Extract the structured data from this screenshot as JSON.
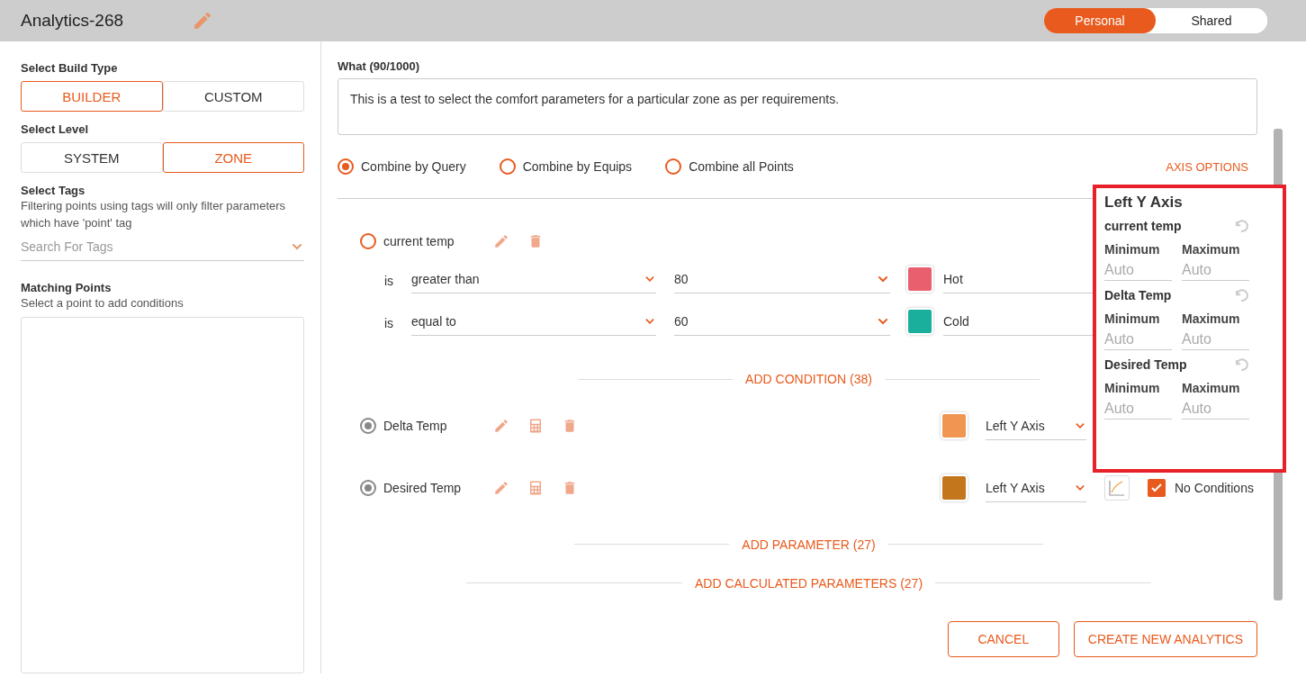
{
  "header": {
    "title": "Analytics-268",
    "scope_toggle": [
      {
        "label": "Personal",
        "selected": true
      },
      {
        "label": "Shared",
        "selected": false
      }
    ]
  },
  "sidebar": {
    "build_type": {
      "label": "Select Build Type",
      "options": [
        {
          "label": "BUILDER",
          "selected": true
        },
        {
          "label": "CUSTOM",
          "selected": false
        }
      ]
    },
    "level": {
      "label": "Select Level",
      "options": [
        {
          "label": "SYSTEM",
          "selected": false
        },
        {
          "label": "ZONE",
          "selected": true
        }
      ]
    },
    "tags": {
      "label": "Select Tags",
      "hint": "Filtering points using tags will only filter parameters which have 'point' tag",
      "placeholder": "Search For Tags"
    },
    "matching_points": {
      "label": "Matching Points",
      "hint": "Select a point to add conditions"
    }
  },
  "what": {
    "label": "What (90/1000)",
    "value": "This is a test to select the comfort parameters for a particular zone as per requirements."
  },
  "combine_options": [
    {
      "label": "Combine by Query",
      "selected": true
    },
    {
      "label": "Combine by Equips",
      "selected": false
    },
    {
      "label": "Combine all Points",
      "selected": false
    }
  ],
  "axis_options_link": "AXIS OPTIONS",
  "parameters": [
    {
      "kind": "query",
      "name": "current temp",
      "selected": false,
      "conditions": [
        {
          "operator": "is",
          "comparison": "greater than",
          "value": "80",
          "color": "#e95f6e",
          "label": "Hot"
        },
        {
          "operator": "is",
          "comparison": "equal to",
          "value": "60",
          "color": "#1aae9d",
          "label": "Cold"
        }
      ],
      "add_condition": "ADD CONDITION (38)"
    },
    {
      "kind": "point",
      "name": "Delta Temp",
      "selected": true,
      "color": "#f09552",
      "axis": "Left Y Axis"
    },
    {
      "kind": "point",
      "name": "Desired Temp",
      "selected": true,
      "color": "#c4761d",
      "axis": "Left Y Axis",
      "no_conditions": {
        "label": "No Conditions",
        "checked": true
      }
    }
  ],
  "add_links": [
    "ADD PARAMETER (27)",
    "ADD CALCULATED PARAMETERS (27)"
  ],
  "axis_popup": {
    "title": "Left Y Axis",
    "items": [
      {
        "name": "current temp",
        "min_label": "Minimum",
        "max_label": "Maximum",
        "min_placeholder": "Auto",
        "max_placeholder": "Auto"
      },
      {
        "name": "Delta Temp",
        "min_label": "Minimum",
        "max_label": "Maximum",
        "min_placeholder": "Auto",
        "max_placeholder": "Auto"
      },
      {
        "name": "Desired Temp",
        "min_label": "Minimum",
        "max_label": "Maximum",
        "min_placeholder": "Auto",
        "max_placeholder": "Auto"
      }
    ]
  },
  "buttons": [
    "CANCEL",
    "CREATE NEW ANALYTICS"
  ]
}
